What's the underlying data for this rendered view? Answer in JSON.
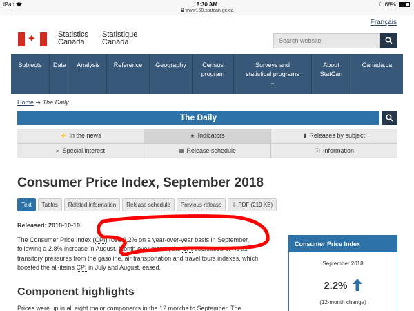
{
  "status_bar": {
    "device": "iPad",
    "time": "8:30 AM",
    "url": "www150.statcan.gc.ca",
    "battery": "68%"
  },
  "header": {
    "language_link": "Français",
    "signature_en": [
      "Statistics",
      "Canada"
    ],
    "signature_fr": [
      "Statistique",
      "Canada"
    ],
    "search_placeholder": "Search website",
    "flag_icon": "canada-flag-icon",
    "search_icon": "search-icon"
  },
  "nav": [
    {
      "label": "Subjects",
      "label2": ""
    },
    {
      "label": "Data",
      "label2": ""
    },
    {
      "label": "Analysis",
      "label2": ""
    },
    {
      "label": "Reference",
      "label2": ""
    },
    {
      "label": "Geography",
      "label2": ""
    },
    {
      "label": "Census",
      "label2": "program"
    },
    {
      "label": "Surveys and",
      "label2": "statistical programs"
    },
    {
      "label": "About",
      "label2": "StatCan"
    },
    {
      "label": "Canada.ca",
      "label2": ""
    }
  ],
  "breadcrumb": {
    "home": "Home",
    "separator": "➔",
    "current": "The Daily"
  },
  "daily": {
    "title": "The Daily"
  },
  "subnav": [
    {
      "label": "In the news",
      "icon": "bolt-icon"
    },
    {
      "label": "Indicators",
      "icon": "star-icon",
      "active": true
    },
    {
      "label": "Releases by subject",
      "icon": "book-icon"
    },
    {
      "label": "Special interest",
      "icon": "link-icon"
    },
    {
      "label": "Release schedule",
      "icon": "calendar-icon"
    },
    {
      "label": "Information",
      "icon": "info-icon"
    }
  ],
  "article": {
    "title": "Consumer Price Index, September 2018",
    "tabs": [
      "Text",
      "Tables",
      "Related information",
      "Release schedule",
      "Previous release",
      "PDF (219 KB)"
    ],
    "active_tab": "Text",
    "released": "Released: 2018-10-19",
    "para_parts": [
      "The Consumer Price Index (",
      "CPI",
      ") rose 2.2% on a year-over-year basis in September, following a 2.8% increase in August. Month over month, the ",
      "CPI",
      " decreased 0.4% as transitory pressures from the gasoline, air transportation and travel tours indexes, which boosted the all-items ",
      "CPI",
      " in July and August, eased."
    ],
    "h2": "Component highlights",
    "para2": "Prices were up in all eight major components in the 12 months to September. The"
  },
  "panel": {
    "title": "Consumer Price Index",
    "month": "September 2018",
    "value": "2.2%",
    "caption": "(12-month change)",
    "arrow_icon": "up-arrow-icon",
    "arrow_color": "#2c72a8"
  },
  "colors": {
    "nav": "#38587a",
    "accent": "#2c72a8",
    "dark": "#26374a",
    "annotation": "#ff0000"
  }
}
